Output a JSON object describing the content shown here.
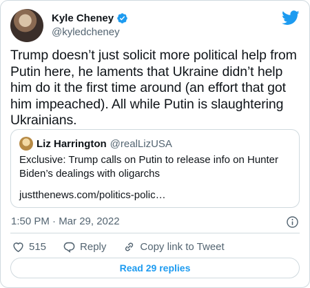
{
  "author": {
    "name": "Kyle Cheney",
    "handle": "@kyledcheney"
  },
  "tweet": {
    "text": "Trump doesn’t just solicit more political help from Putin here, he laments that Ukraine didn’t help him do it the first time around (an effort that got him impeached). All while Putin is slaughtering Ukrainians.",
    "timestamp": "1:50 PM · Mar 29, 2022"
  },
  "quoted_tweet": {
    "name": "Liz Harrington",
    "handle": "@realLizUSA",
    "text": "Exclusive: Trump calls on Putin to release info on Hunter Biden’s dealings with oligarchs",
    "link": "justthenews.com/politics-polic…"
  },
  "actions": {
    "likes": "515",
    "reply_label": "Reply",
    "copy_label": "Copy link to Tweet"
  },
  "replies_button": "Read 29 replies",
  "colors": {
    "accent": "#1d9bf0",
    "secondary_text": "#536471",
    "border": "#cfd9de"
  }
}
